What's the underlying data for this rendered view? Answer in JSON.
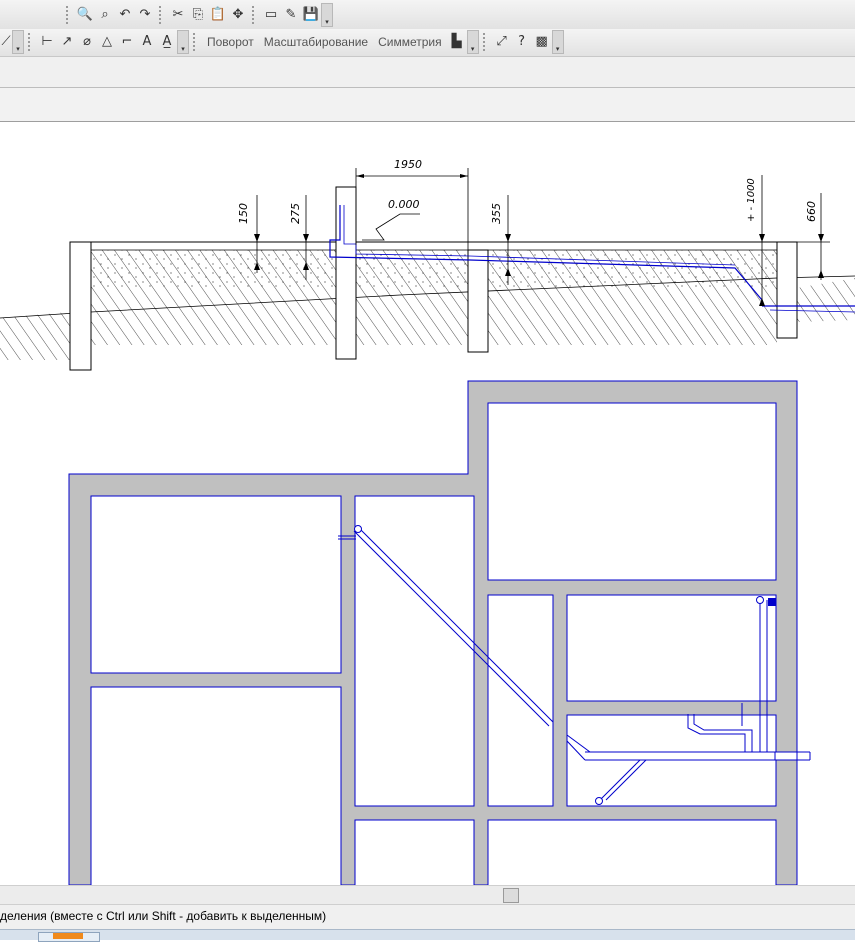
{
  "toolbar": {
    "top_icons": [
      "zoom-in-icon",
      "zoom-window-icon",
      "undo-icon",
      "redo-icon",
      "cut-icon",
      "copy-icon",
      "paste-icon",
      "pan-icon",
      "layout-icon",
      "properties-icon",
      "save-icon"
    ],
    "bottom_icons": [
      "linear-dimension-icon",
      "angle-dimension-icon",
      "diameter-dimension-icon",
      "arc-dimension-icon",
      "leader-icon",
      "text-icon",
      "roughness-icon"
    ],
    "rotate_label": "Поворот",
    "scale_label": "Масштабирование",
    "symmetry_label": "Симметрия",
    "extra_icons": [
      "copy-array-icon",
      "measure-icon",
      "query-icon",
      "hatch-icon"
    ]
  },
  "drawing": {
    "dimension_1950": "1950",
    "level_label": "0.000",
    "dim_150": "150",
    "dim_275": "275",
    "dim_355": "355",
    "dim_1000": "+ - 1000",
    "dim_660": "660",
    "line_color": "#0000cc",
    "wall_fill": "#c0c0c0"
  },
  "status": {
    "message": "деления (вместе с Ctrl или Shift - добавить к выделенным)"
  }
}
